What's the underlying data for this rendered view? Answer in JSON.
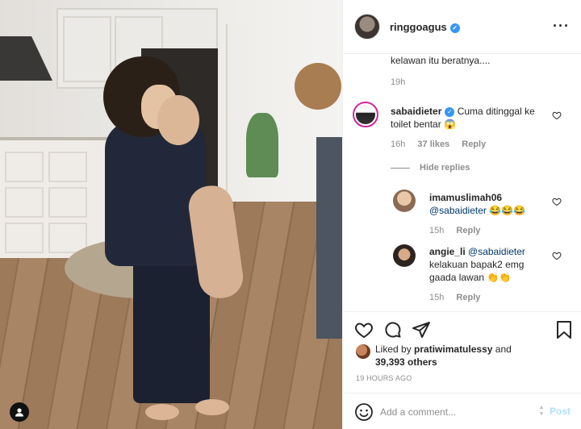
{
  "post": {
    "author": "ringgoagus",
    "verified": true
  },
  "photo": {
    "badge_icon": "user-icon"
  },
  "caption_tail": {
    "text": "kelawan itu beratnya....",
    "time": "19h"
  },
  "comments": [
    {
      "user": "sabaidieter",
      "verified": true,
      "text": "Cuma ditinggal ke toilet bentar 😱",
      "line1": "Cuma ditinggal ke",
      "line2": "toilet bentar 😱",
      "time": "16h",
      "likes": "37 likes",
      "reply": "Reply"
    }
  ],
  "hide_replies": "Hide replies",
  "replies": [
    {
      "user": "imamuslimah06",
      "mention": "@sabaidieter",
      "text": "😂😂😂",
      "time": "15h",
      "reply": "Reply"
    },
    {
      "user": "angie_li",
      "mention": "@sabaidieter",
      "text": "kelakuan bapak2 emg gaada lawan 👏👏",
      "line2": "kelakuan bapak2 emg",
      "line3": "gaada lawan 👏👏",
      "time": "15h",
      "reply": "Reply"
    }
  ],
  "likes": {
    "prefix": "Liked by",
    "user": "pratiwimatulessy",
    "and": "and",
    "count": "39,393 others"
  },
  "time_ago": "19 HOURS AGO",
  "add_comment": {
    "placeholder": "Add a comment...",
    "post_label": "Post"
  },
  "colors": {
    "verified": "#3897f0",
    "post_button_disabled": "#b2dffc",
    "story_ring": "#d6249f",
    "muted": "#8e8e8e",
    "mention": "#00376b"
  }
}
